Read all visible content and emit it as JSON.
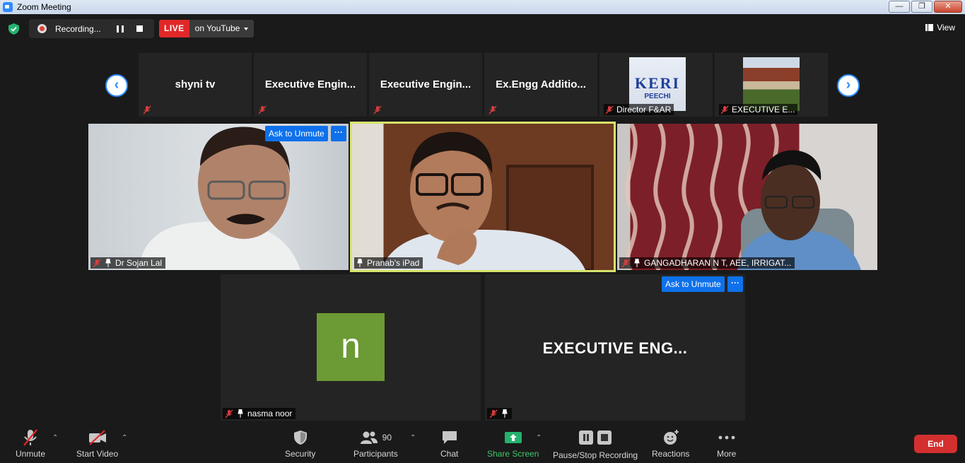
{
  "window": {
    "title": "Zoom Meeting",
    "controls": [
      "—",
      "❐",
      "✕"
    ]
  },
  "topbar": {
    "recording_label": "Recording...",
    "live_label": "LIVE",
    "live_destination": "on YouTube",
    "view_label": "View"
  },
  "strip": {
    "thumbnails": [
      {
        "name": "shyni tv"
      },
      {
        "name": "Executive  Engin..."
      },
      {
        "name": "Executive  Engin..."
      },
      {
        "name": "Ex.Engg  Additio..."
      },
      {
        "name": "Director F&AR",
        "image_text": "KERI",
        "image_subtext": "PEECHI"
      },
      {
        "name": "EXECUTIVE E..."
      }
    ]
  },
  "tiles": {
    "sojan": {
      "name": "Dr Sojan Lal",
      "ask_unmute": "Ask to Unmute",
      "more": "···"
    },
    "pranab": {
      "name": "Pranab's iPad"
    },
    "gangadharan": {
      "name": "GANGADHARAN N T, AEE, IRRIGAT..."
    },
    "nasma": {
      "name": "nasma noor",
      "avatar_letter": "n"
    },
    "exec": {
      "center_name": "EXECUTIVE  ENG...",
      "ask_unmute": "Ask to Unmute",
      "more": "···"
    }
  },
  "toolbar": {
    "unmute": "Unmute",
    "start_video": "Start Video",
    "security": "Security",
    "participants": "Participants",
    "participants_count": "90",
    "chat": "Chat",
    "share_screen": "Share Screen",
    "pause_stop": "Pause/Stop Recording",
    "reactions": "Reactions",
    "more": "More",
    "end": "End"
  },
  "colors": {
    "accent_blue": "#0e71eb",
    "live_red": "#e02828",
    "end_red": "#d32f2f",
    "share_green": "#3ec76a",
    "active_speaker": "#d6e56b",
    "avatar_green": "#6c9a34"
  }
}
